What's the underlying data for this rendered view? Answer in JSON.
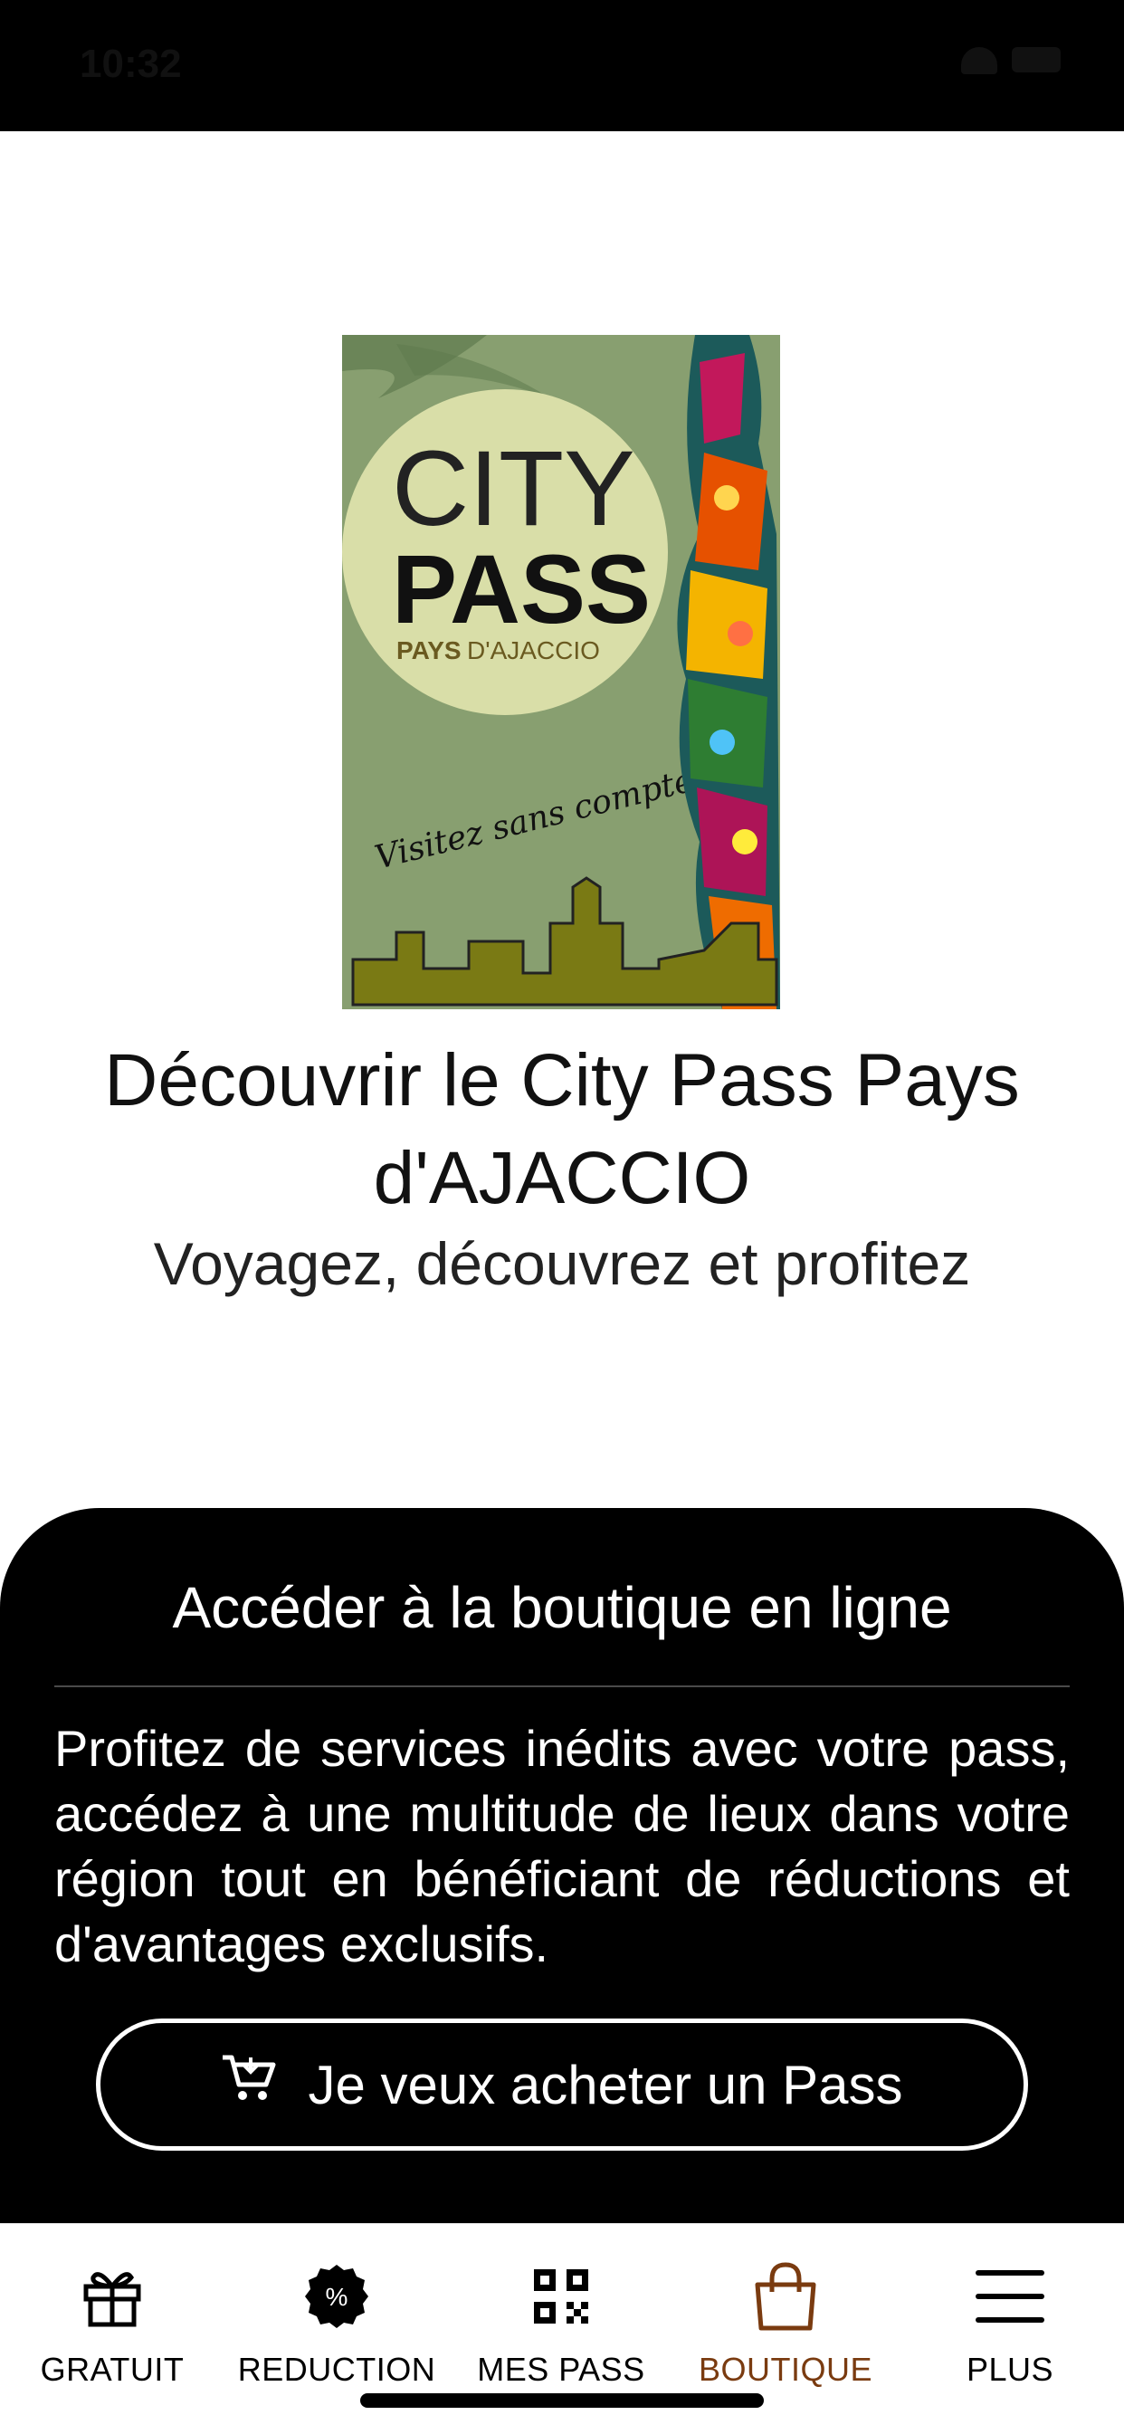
{
  "status_bar": {
    "time": "10:32"
  },
  "poster": {
    "logo_line1": "CITY",
    "logo_line2": "PASS",
    "logo_sub_bold": "PAYS",
    "logo_sub": "D'AJACCIO",
    "tagline": "Visitez sans compter!"
  },
  "main": {
    "title": "Découvrir le City Pass Pays d'AJACCIO",
    "subtitle": "Voyagez, découvrez et profitez"
  },
  "shop_card": {
    "title": "Accéder à la boutique en ligne",
    "body": "Profitez de services inédits avec votre pass, accédez à une multitude de lieux dans votre région tout en bénéficiant de réductions et d'avantages exclusifs.",
    "button_label": "Je veux acheter un Pass",
    "button_icon": "cart-icon"
  },
  "tabbar": {
    "active_color": "#7a3b10",
    "tabs": [
      {
        "label": "GRATUIT",
        "icon": "gift-icon"
      },
      {
        "label": "REDUCTION",
        "icon": "percent-badge-icon"
      },
      {
        "label": "MES PASS",
        "icon": "qr-code-icon"
      },
      {
        "label": "BOUTIQUE",
        "icon": "shopping-bag-icon",
        "active": true
      },
      {
        "label": "PLUS",
        "icon": "menu-icon"
      }
    ]
  }
}
